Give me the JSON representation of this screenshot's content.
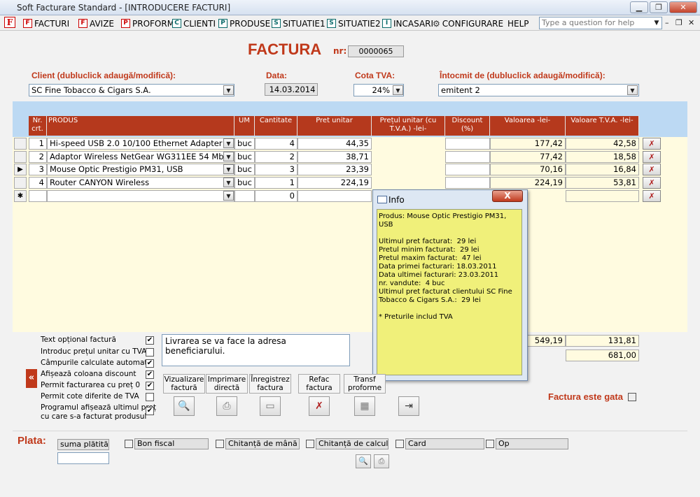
{
  "window": {
    "title": "Soft Facturare Standard - [INTRODUCERE FACTURI]",
    "app_icon": "F"
  },
  "menu": {
    "items": [
      {
        "label": "FACTURI",
        "icon": "F"
      },
      {
        "label": "AVIZE",
        "icon": "F"
      },
      {
        "label": "PROFORME",
        "icon": "P"
      },
      {
        "label": "CLIENTI",
        "icon": "C"
      },
      {
        "label": "PRODUSE",
        "icon": "P"
      },
      {
        "label": "SITUATIE1",
        "icon": "S"
      },
      {
        "label": "SITUATIE2",
        "icon": "S"
      },
      {
        "label": "INCASARI",
        "icon": "I"
      },
      {
        "label": "CONFIGURARE",
        "icon": "gear-icon"
      },
      {
        "label": "HELP",
        "icon": ""
      }
    ],
    "help_placeholder": "Type a question for help"
  },
  "invoice": {
    "title": "FACTURA",
    "nr_label": "nr:",
    "nr_value": "0000065",
    "client_label": "Client (dubluclick adaugă/modifică):",
    "client_value": "SC Fine Tobacco & Cigars S.A.",
    "date_label": "Data:",
    "date_value": "14.03.2014",
    "vat_label": "Cota TVA:",
    "vat_value": "24%",
    "issuer_label": "Întocmit de (dubluclick adaugă/modifică):",
    "issuer_value": "emitent 2"
  },
  "grid": {
    "headers": [
      "Nr. crt.",
      "PRODUS",
      "UM",
      "Cantitate",
      "Pret unitar",
      "Prețul unitar (cu T.V.A.) -lei-",
      "Discount (%)",
      "Valoarea -lei-",
      "Valoare T.V.A. -lei-"
    ],
    "rows": [
      {
        "selector": "",
        "nr": "1",
        "product": "Hi-speed USB 2.0 10/100 Ethernet Adapter",
        "um": "buc",
        "qty": "4",
        "price": "44,35",
        "price_vat": "",
        "discount": "",
        "value": "177,42",
        "vat": "42,58"
      },
      {
        "selector": "",
        "nr": "2",
        "product": "Adaptor Wireless NetGear WG311EE 54 Mbps",
        "um": "buc",
        "qty": "2",
        "price": "38,71",
        "price_vat": "",
        "discount": "",
        "value": "77,42",
        "vat": "18,58"
      },
      {
        "selector": "▶",
        "nr": "3",
        "product": "Mouse Optic Prestigio PM31, USB",
        "um": "buc",
        "qty": "3",
        "price": "23,39",
        "price_vat": "",
        "discount": "",
        "value": "70,16",
        "vat": "16,84"
      },
      {
        "selector": "",
        "nr": "4",
        "product": "Router CANYON Wireless",
        "um": "buc",
        "qty": "1",
        "price": "224,19",
        "price_vat": "",
        "discount": "",
        "value": "224,19",
        "vat": "53,81"
      }
    ],
    "new_row": {
      "selector": "✱",
      "qty": "0"
    }
  },
  "totals": {
    "value_total": "549,19",
    "vat_total": "131,81",
    "grand_total": "681,00"
  },
  "options": [
    {
      "label": "Text opțional factură",
      "checked": true
    },
    {
      "label": "Introduc prețul unitar cu TVA",
      "checked": false
    },
    {
      "label": "Câmpurile calculate automat",
      "checked": true
    },
    {
      "label": "Afișează coloana discount",
      "checked": true
    },
    {
      "label": "Permit facturarea cu preț 0",
      "checked": true
    },
    {
      "label": "Permit cote diferite de TVA",
      "checked": false
    },
    {
      "label": "Programul afișează ultimul preț\ncu care s-a facturat produsul",
      "checked": true
    }
  ],
  "note_text": "Livrarea se va face la adresa beneficiarului.",
  "actions": [
    {
      "label": "Vizualizare\nfactură",
      "icon": "preview-icon"
    },
    {
      "label": "Imprimare\ndirectă",
      "icon": "print-icon"
    },
    {
      "label": "Înregistrez\nfactura",
      "icon": "save-icon"
    },
    {
      "label": "Refac\nfactura",
      "icon": "undo-icon"
    },
    {
      "label": "Transf\nproforme",
      "icon": "table-icon"
    },
    {
      "label": "",
      "icon": "exit-icon"
    }
  ],
  "ready_label": "Factura este gata",
  "payment": {
    "label": "Plata:",
    "amount_label": "suma plătită:",
    "amount_value": "",
    "methods": [
      "Bon fiscal",
      "Chitanță de mână",
      "Chitanță de calculator",
      "Card",
      "Op"
    ]
  },
  "info_popup": {
    "title": "Info",
    "close": "X",
    "lines": [
      "Produs: Mouse Optic Prestigio PM31, USB",
      "",
      "Ultimul pret facturat:  29 lei",
      "Pretul minim facturat:  29 lei",
      "Pretul maxim facturat:  47 lei",
      "Data primei facturari: 18.03.2011",
      "Data ultimei facturari: 23.03.2011",
      "nr. vandute:  4 buc",
      "Ultimul pret facturat clientului SC Fine",
      "Tobacco & Cigars S.A.:  29 lei",
      "",
      "* Preturile includ TVA"
    ]
  }
}
